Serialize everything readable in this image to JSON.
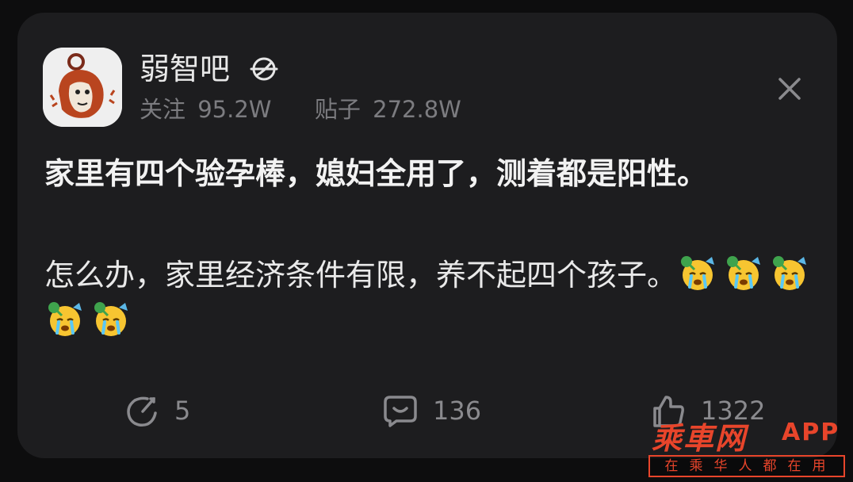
{
  "forum": {
    "name": "弱智吧",
    "follow_label": "关注",
    "follow_count": "95.2W",
    "posts_label": "贴子",
    "posts_count": "272.8W"
  },
  "post": {
    "title": "家里有四个验孕棒，媳妇全用了，测着都是阳性。",
    "body": "怎么办，家里经济条件有限，养不起四个孩子。"
  },
  "actions": {
    "share_count": "5",
    "comment_count": "136",
    "like_count": "1322"
  },
  "icons": {
    "avatar": "avatar-image",
    "verified": "globe-icon",
    "close": "close-icon",
    "share": "share-icon",
    "comment": "comment-icon",
    "like": "thumbs-up-icon",
    "emoji": "crying-party-emoji"
  },
  "watermark": {
    "logo": "乘車网",
    "app": "APP",
    "slogan": "在乘华人都在用"
  },
  "colors": {
    "background": "#0d0d0e",
    "card": "#1d1d1f",
    "muted_text": "#7c7c80",
    "watermark_accent": "#e8452b"
  }
}
